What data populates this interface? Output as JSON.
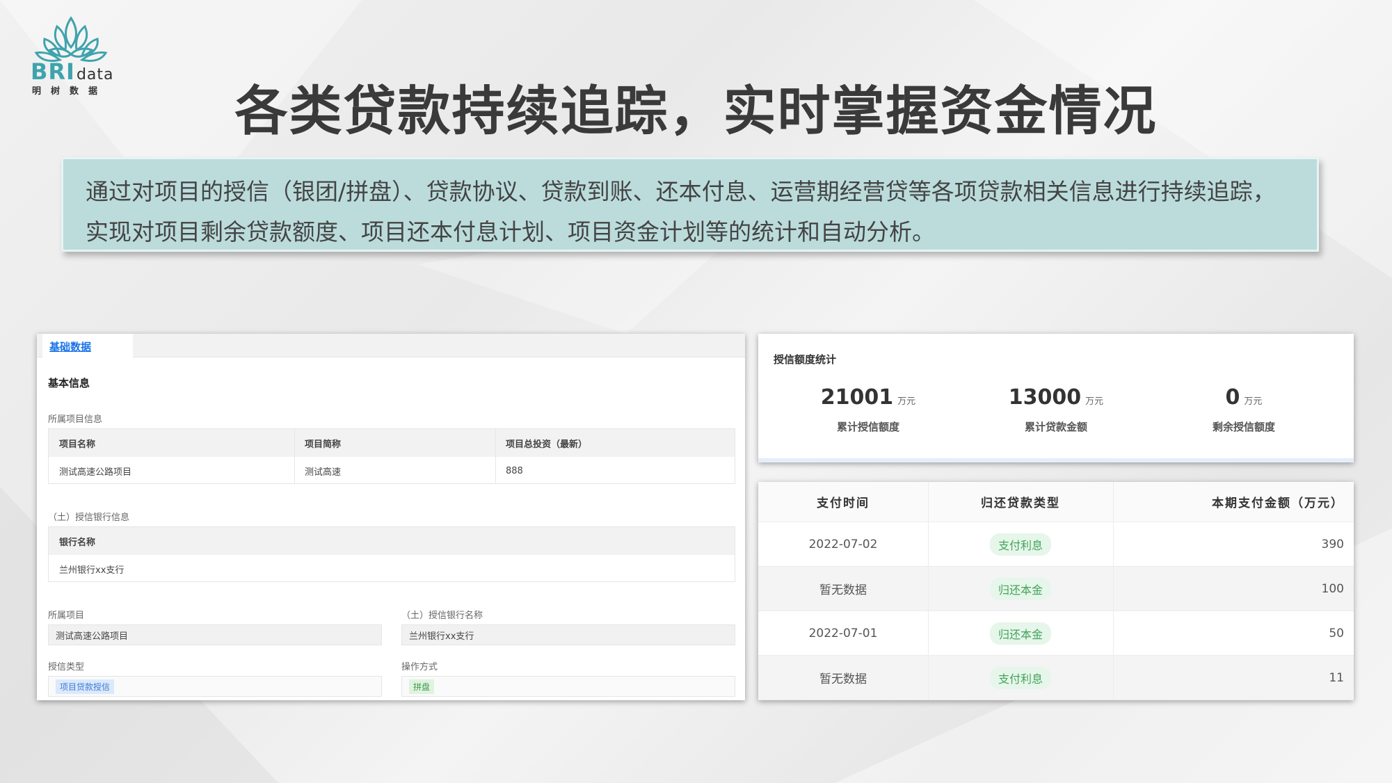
{
  "logo": {
    "brand": "BRI",
    "brand_suffix": "data",
    "subtitle": "明树数据"
  },
  "headline": "各类贷款持续追踪，实时掌握资金情况",
  "description": {
    "line1": "通过对项目的授信（银团/拼盘）、贷款协议、贷款到账、还本付息、运营期经营贷等各项贷款相关信息进行持续追踪，",
    "line2": "实现对项目剩余贷款额度、项目还本付息计划、项目资金计划等的统计和自动分析。"
  },
  "left_panel": {
    "tab": "基础数据",
    "section_title": "基本信息",
    "project_info_label": "所属项目信息",
    "project_table": {
      "headers": [
        "项目名称",
        "项目简称",
        "项目总投资（最新）"
      ],
      "row": [
        "测试高速公路项目",
        "测试高速",
        "888"
      ]
    },
    "bank_info_label": "（土）授信银行信息",
    "bank_table": {
      "header": "银行名称",
      "row": "兰州银行xx支行"
    },
    "fields": {
      "project_label": "所属项目",
      "project_value": "测试高速公路项目",
      "bank_name_label": "（土）授信银行名称",
      "bank_name_value": "兰州银行xx支行",
      "credit_type_label": "授信类型",
      "credit_type_value": "项目贷款授信",
      "operation_label": "操作方式",
      "operation_value": "拼盘"
    }
  },
  "stats": {
    "title": "授信额度统计",
    "items": [
      {
        "value": "21001",
        "unit": "万元",
        "label": "累计授信额度"
      },
      {
        "value": "13000",
        "unit": "万元",
        "label": "累计贷款金额"
      },
      {
        "value": "0",
        "unit": "万元",
        "label": "剩余授信额度"
      }
    ]
  },
  "payment_table": {
    "headers": [
      "支付时间",
      "归还贷款类型",
      "本期支付金额（万元）"
    ],
    "rows": [
      {
        "time": "2022-07-02",
        "type": "支付利息",
        "amount": "390"
      },
      {
        "time": "暂无数据",
        "type": "归还本金",
        "amount": "100"
      },
      {
        "time": "2022-07-01",
        "type": "归还本金",
        "amount": "50"
      },
      {
        "time": "暂无数据",
        "type": "支付利息",
        "amount": "11"
      }
    ]
  }
}
